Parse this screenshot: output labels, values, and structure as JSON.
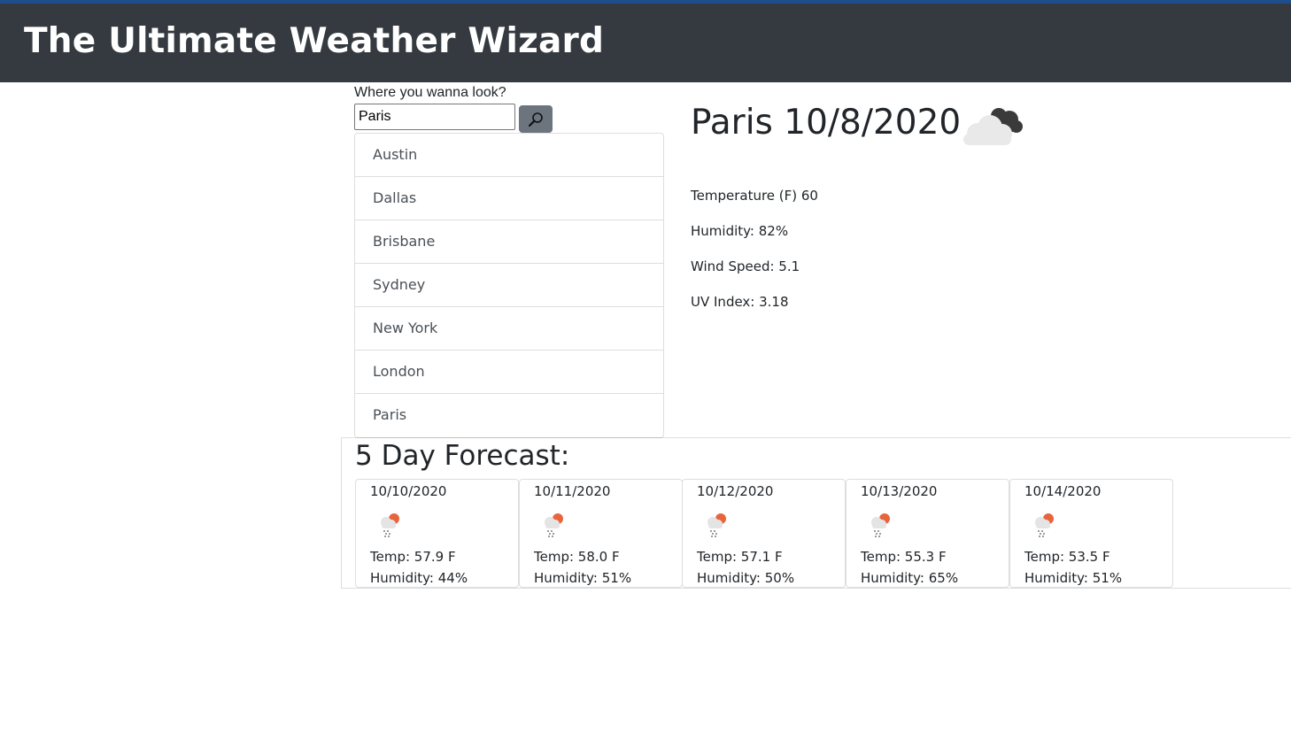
{
  "header": {
    "title": "The Ultimate Weather Wizard"
  },
  "search": {
    "label": "Where you wanna look?",
    "value": "Paris",
    "button_icon": "search-icon"
  },
  "cities": [
    "Austin",
    "Dallas",
    "Brisbane",
    "Sydney",
    "New York",
    "London",
    "Paris"
  ],
  "current": {
    "title": "Paris 10/8/2020",
    "icon": "cloudy-icon",
    "temperature": "Temperature (F) 60",
    "humidity": "Humidity: 82%",
    "wind": "Wind Speed: 5.1",
    "uv": "UV Index: 3.18"
  },
  "forecast": {
    "title": "5 Day Forecast:",
    "days": [
      {
        "date": "10/10/2020",
        "icon": "rain-sun-icon",
        "temp": "Temp: 57.9 F",
        "humidity": "Humidity: 44%"
      },
      {
        "date": "10/11/2020",
        "icon": "rain-sun-icon",
        "temp": "Temp: 58.0 F",
        "humidity": "Humidity: 51%"
      },
      {
        "date": "10/12/2020",
        "icon": "rain-sun-icon",
        "temp": "Temp: 57.1 F",
        "humidity": "Humidity: 50%"
      },
      {
        "date": "10/13/2020",
        "icon": "rain-sun-icon",
        "temp": "Temp: 55.3 F",
        "humidity": "Humidity: 65%"
      },
      {
        "date": "10/14/2020",
        "icon": "rain-sun-icon",
        "temp": "Temp: 53.5 F",
        "humidity": "Humidity: 51%"
      }
    ]
  },
  "colors": {
    "header_bg": "#343a40",
    "button_bg": "#6c757d",
    "sun_accent": "#e8643c"
  }
}
